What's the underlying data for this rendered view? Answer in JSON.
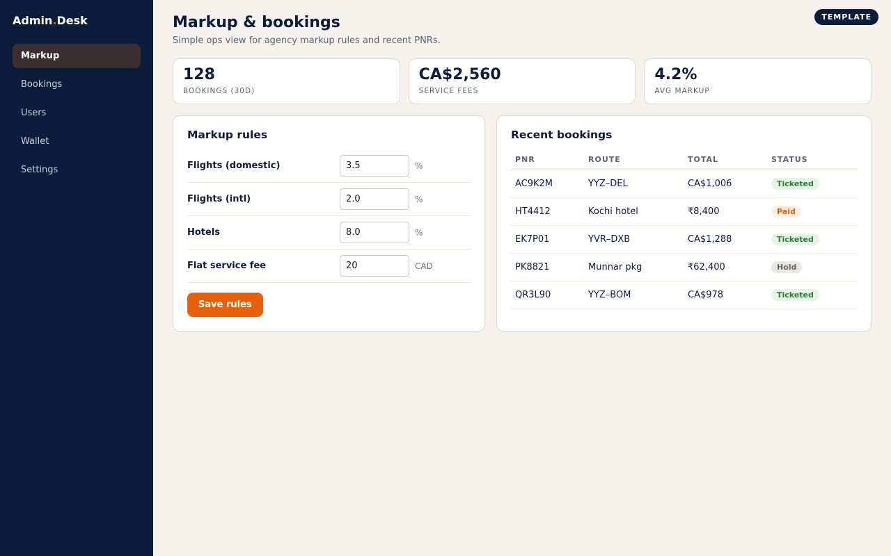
{
  "brand": {
    "name_part1": "Admin",
    "dot": ".",
    "name_part2": "Desk"
  },
  "sidebar": {
    "items": [
      {
        "label": "Markup",
        "active": true
      },
      {
        "label": "Bookings",
        "active": false
      },
      {
        "label": "Users",
        "active": false
      },
      {
        "label": "Wallet",
        "active": false
      },
      {
        "label": "Settings",
        "active": false
      }
    ]
  },
  "header": {
    "title": "Markup & bookings",
    "subtitle": "Simple ops view for agency markup rules and recent PNRs.",
    "badge": "TEMPLATE"
  },
  "stats": [
    {
      "value": "128",
      "label": "BOOKINGS (30D)"
    },
    {
      "value": "CA$2,560",
      "label": "SERVICE FEES"
    },
    {
      "value": "4.2%",
      "label": "AVG MARKUP"
    }
  ],
  "markup": {
    "title": "Markup rules",
    "rules": [
      {
        "label": "Flights (domestic)",
        "value": "3.5",
        "unit": "%"
      },
      {
        "label": "Flights (intl)",
        "value": "2.0",
        "unit": "%"
      },
      {
        "label": "Hotels",
        "value": "8.0",
        "unit": "%"
      },
      {
        "label": "Flat service fee",
        "value": "20",
        "unit": "CAD"
      }
    ],
    "save_label": "Save rules"
  },
  "bookings": {
    "title": "Recent bookings",
    "columns": [
      "PNR",
      "ROUTE",
      "TOTAL",
      "STATUS"
    ],
    "rows": [
      {
        "pnr": "AC9K2M",
        "route": "YYZ–DEL",
        "total": "CA$1,006",
        "status": "Ticketed"
      },
      {
        "pnr": "HT4412",
        "route": "Kochi hotel",
        "total": "₹8,400",
        "status": "Paid"
      },
      {
        "pnr": "EK7P01",
        "route": "YVR–DXB",
        "total": "CA$1,288",
        "status": "Ticketed"
      },
      {
        "pnr": "PK8821",
        "route": "Munnar pkg",
        "total": "₹62,400",
        "status": "Hold"
      },
      {
        "pnr": "QR3L90",
        "route": "YYZ–BOM",
        "total": "CA$978",
        "status": "Ticketed"
      }
    ]
  },
  "colors": {
    "sidebar_bg": "#0b1d3a",
    "accent": "#e8600a",
    "active_nav_bg": "#3a2e31",
    "status_ticketed": "#2f7d3a",
    "status_paid": "#d9610e",
    "status_hold": "#6b645c"
  }
}
